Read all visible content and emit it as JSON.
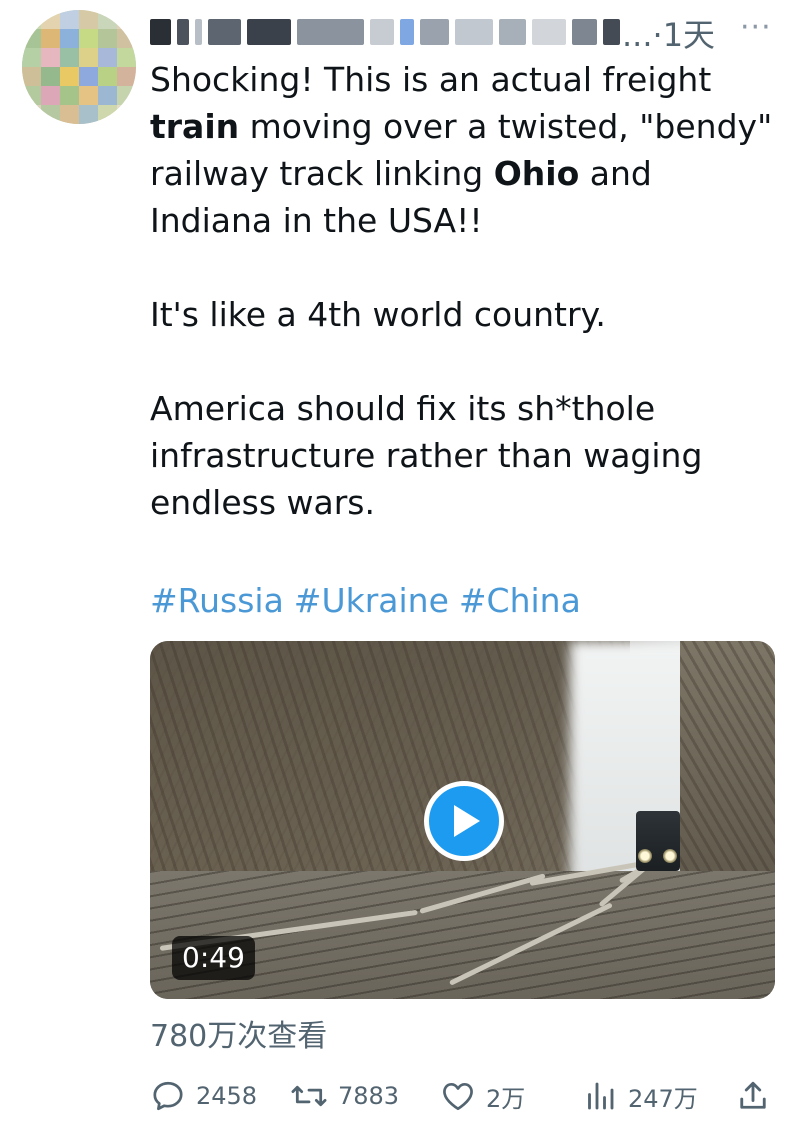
{
  "header": {
    "timestamp": "...·1天",
    "more_icon": "more-horizontal-icon"
  },
  "tweet": {
    "paragraphs": [
      {
        "segments": [
          {
            "text": "Shocking! This is an actual freight ",
            "bold": false
          },
          {
            "text": "train",
            "bold": true
          },
          {
            "text": " moving over a twisted, \"bendy\" railway track linking ",
            "bold": false
          },
          {
            "text": "Ohio",
            "bold": true
          },
          {
            "text": " and Indiana in the USA!!",
            "bold": false
          }
        ]
      },
      {
        "segments": [
          {
            "text": "It's like a 4th world country.",
            "bold": false
          }
        ]
      },
      {
        "segments": [
          {
            "text": "America should fix its sh*thole infrastructure rather than waging endless wars.",
            "bold": false
          }
        ]
      }
    ],
    "hashtags": [
      "#Russia",
      "#Ukraine",
      "#China"
    ],
    "hashtag_color": "#4a99d6"
  },
  "video": {
    "duration": "0:49",
    "play_icon": "play-icon",
    "accent": "#1d9bf0"
  },
  "views_text": "780万次查看",
  "actions": {
    "reply": {
      "icon": "reply-icon",
      "count": "2458"
    },
    "retweet": {
      "icon": "retweet-icon",
      "count": "7883"
    },
    "like": {
      "icon": "heart-icon",
      "count": "2万"
    },
    "views": {
      "icon": "analytics-icon",
      "count": "247万"
    },
    "share": {
      "icon": "share-icon"
    }
  }
}
